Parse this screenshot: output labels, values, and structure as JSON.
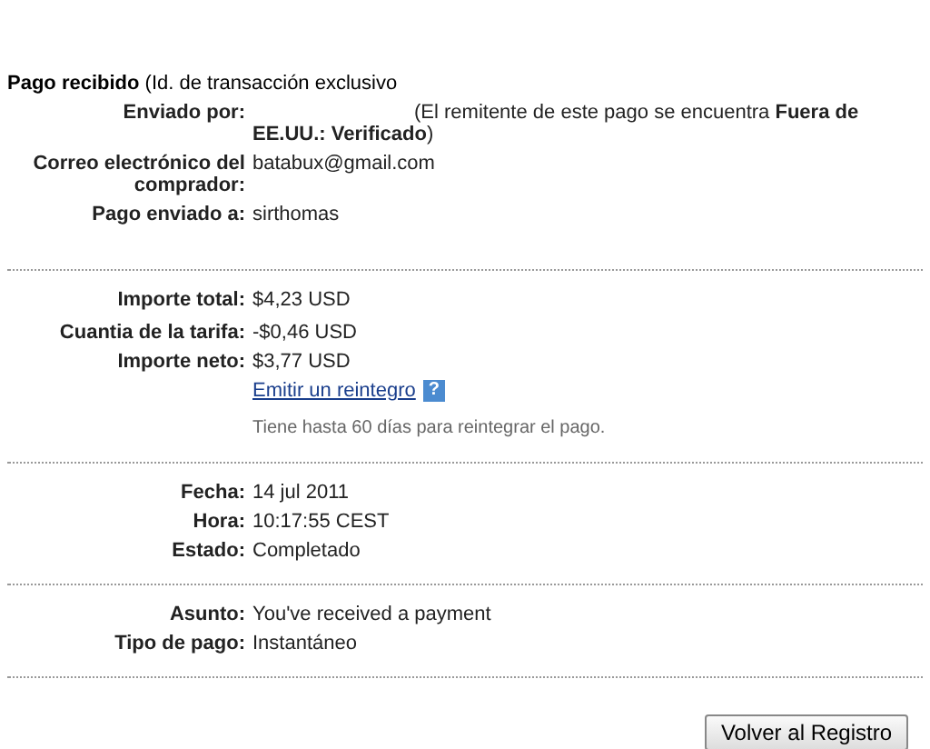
{
  "title": "**Pago recibido** (Id. de transacción exclusivo",
  "sections": [
    {
      "rows": [
        {
          "kind": "sender",
          "label": "Enviado por:",
          "value": "(El remitente de este pago se encuentra **Fuera de EE.UU.: Verificado**)"
        },
        {
          "kind": "field",
          "label": "Correo electrónico del comprador:",
          "value": "batabux@gmail.com"
        },
        {
          "kind": "field",
          "label": "Pago enviado a:",
          "value": "sirthomas"
        }
      ]
    },
    {
      "rows": [
        {
          "kind": "field",
          "label": "Importe total:",
          "value": "$4,23 USD"
        },
        {
          "kind": "field",
          "label": "Cuantia de la tarifa:",
          "value": "-$0,46 USD"
        },
        {
          "kind": "field",
          "label": "Importe neto:",
          "value": "$3,77 USD"
        },
        {
          "kind": "link",
          "value": "Emitir un reintegro",
          "help": "?"
        },
        {
          "kind": "note",
          "value": "Tiene hasta 60 días para reintegrar el pago."
        }
      ]
    },
    {
      "rows": [
        {
          "kind": "field",
          "label": "Fecha:",
          "value": "14 jul 2011"
        },
        {
          "kind": "field",
          "label": "Hora:",
          "value": "10:17:55 CEST"
        },
        {
          "kind": "field",
          "label": "Estado:",
          "value": "Completado"
        }
      ]
    },
    {
      "rows": [
        {
          "kind": "field",
          "label": "Asunto:",
          "value": "You've received a payment"
        },
        {
          "kind": "field",
          "label": "Tipo de pago:",
          "value": "Instantáneo"
        }
      ]
    }
  ],
  "button": "Volver al Registro"
}
